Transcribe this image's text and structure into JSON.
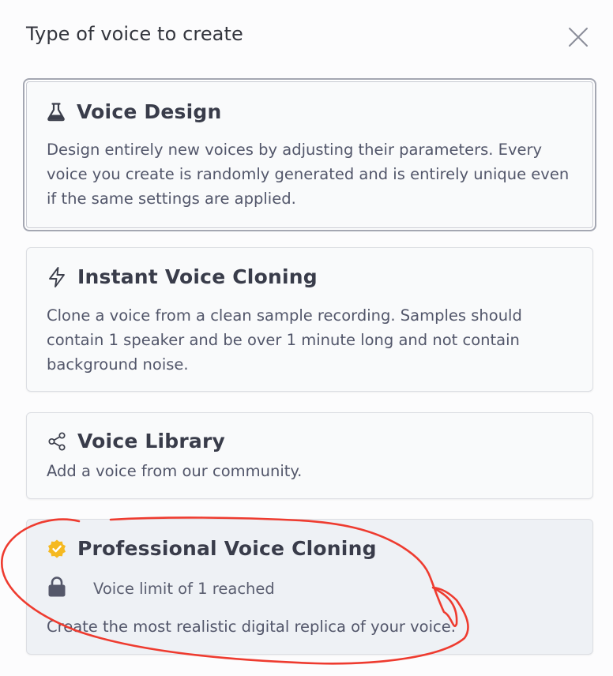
{
  "dialog": {
    "title": "Type of voice to create",
    "close_icon": "close-icon"
  },
  "options": [
    {
      "title": "Voice Design",
      "icon": "flask-icon",
      "description": "Design entirely new voices by adjusting their parameters. Every voice you create is randomly generated and is entirely unique even if the same settings are applied.",
      "selected": true
    },
    {
      "title": "Instant Voice Cloning",
      "icon": "lightning-icon",
      "description": "Clone a voice from a clean sample recording. Samples should contain 1 speaker and be over 1 minute long and not contain background noise."
    },
    {
      "title": "Voice Library",
      "icon": "share-icon",
      "description": "Add a voice from our community."
    },
    {
      "title": "Professional Voice Cloning",
      "icon": "verified-badge-icon",
      "lock_icon": "lock-icon",
      "status": "Voice limit of 1 reached",
      "description": "Create the most realistic digital replica of your voice.",
      "disabled": true
    }
  ],
  "colors": {
    "badge": "#f5b921",
    "annotation_stroke": "#ee3b2f"
  }
}
